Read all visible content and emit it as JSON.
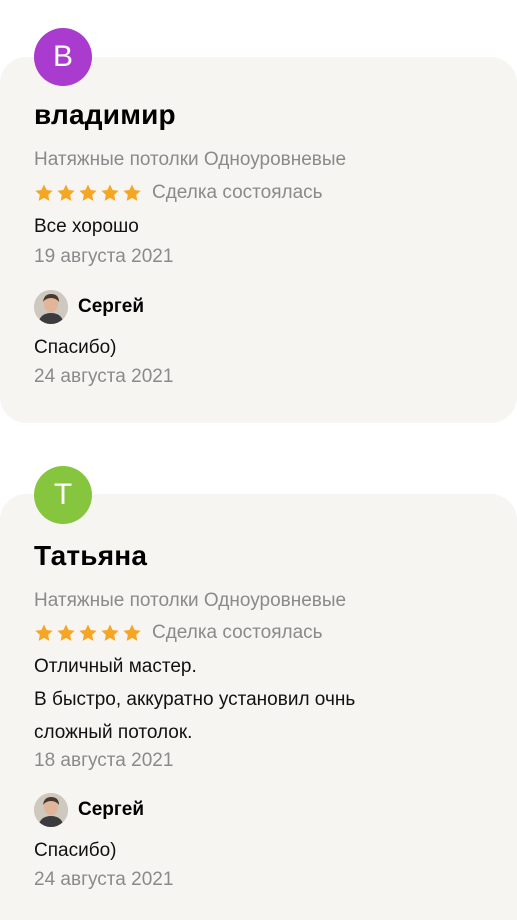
{
  "reviews": [
    {
      "avatar_letter": "В",
      "avatar_color": "#a93bcf",
      "name": "владимир",
      "category": "Натяжные потолки Одноуровневые",
      "rating": 5,
      "deal_status": "Сделка состоялась",
      "text": [
        "Все хорошо"
      ],
      "date": "19 августа 2021",
      "reply": {
        "author": "Сергей",
        "text": "Спасибо)",
        "date": "24 августа 2021"
      }
    },
    {
      "avatar_letter": "Т",
      "avatar_color": "#86c63f",
      "name": "Татьяна",
      "category": "Натяжные потолки Одноуровневые",
      "rating": 5,
      "deal_status": "Сделка состоялась",
      "text": [
        "Отличный мастер.",
        "В быстро, аккуратно установил очнь",
        "сложный потолок."
      ],
      "date": "18 августа 2021",
      "reply": {
        "author": "Сергей",
        "text": "Спасибо)",
        "date": "24 августа 2021"
      }
    }
  ],
  "colors": {
    "star": "#f5a623",
    "card_bg": "#f6f5f2",
    "muted_text": "#8a8a8a"
  },
  "icons": {
    "star": "star-icon",
    "reply_avatar": "user-photo"
  }
}
